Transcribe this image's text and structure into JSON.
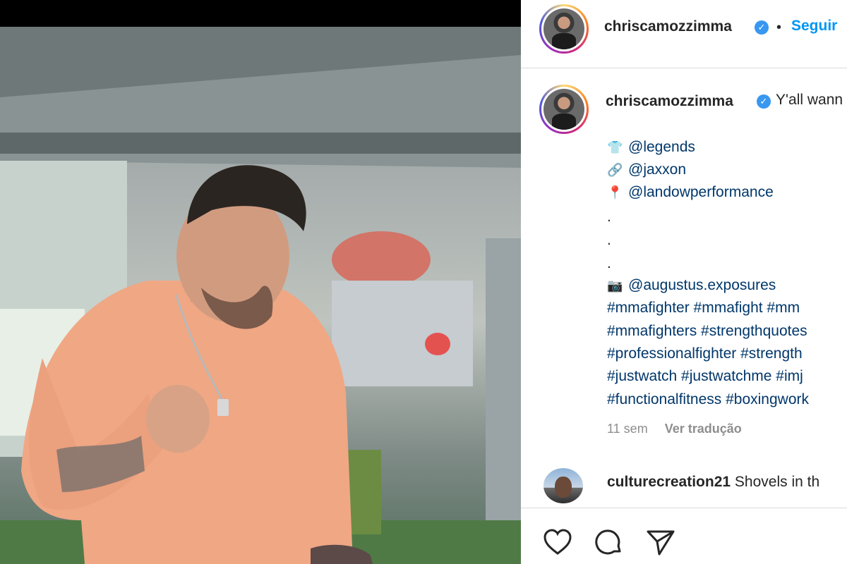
{
  "post": {
    "author": "chriscamozzimma",
    "follow_label": "Seguir",
    "separator": "•",
    "caption_start": "Y'all wann",
    "lines": [
      {
        "emoji": "👕",
        "text": "@legends"
      },
      {
        "emoji": "🔗",
        "text": "@jaxxon"
      },
      {
        "emoji": "📍",
        "text": "@landowperformance"
      }
    ],
    "dots": [
      ".",
      ".",
      "."
    ],
    "photo_credit": {
      "emoji": "📷",
      "text": "@augustus.exposures"
    },
    "hashtag_lines": [
      "#mmafighter #mmafight #mm",
      "#mmafighters #strengthquotes",
      "#professionalfighter #strength",
      "#justwatch #justwatchme #imj",
      "#functionalfitness #boxingwork"
    ],
    "time_ago": "11 sem",
    "translate_label": "Ver tradução"
  },
  "comment": {
    "user": "culturecreation21",
    "text": "Shovels in th"
  },
  "actions": {
    "like_icon": "heart-icon",
    "comment_icon": "comment-icon",
    "share_icon": "send-icon"
  },
  "colors": {
    "link": "#00376b",
    "follow": "#0095f6",
    "verified": "#3897f0",
    "muted": "#8e8e8e"
  }
}
